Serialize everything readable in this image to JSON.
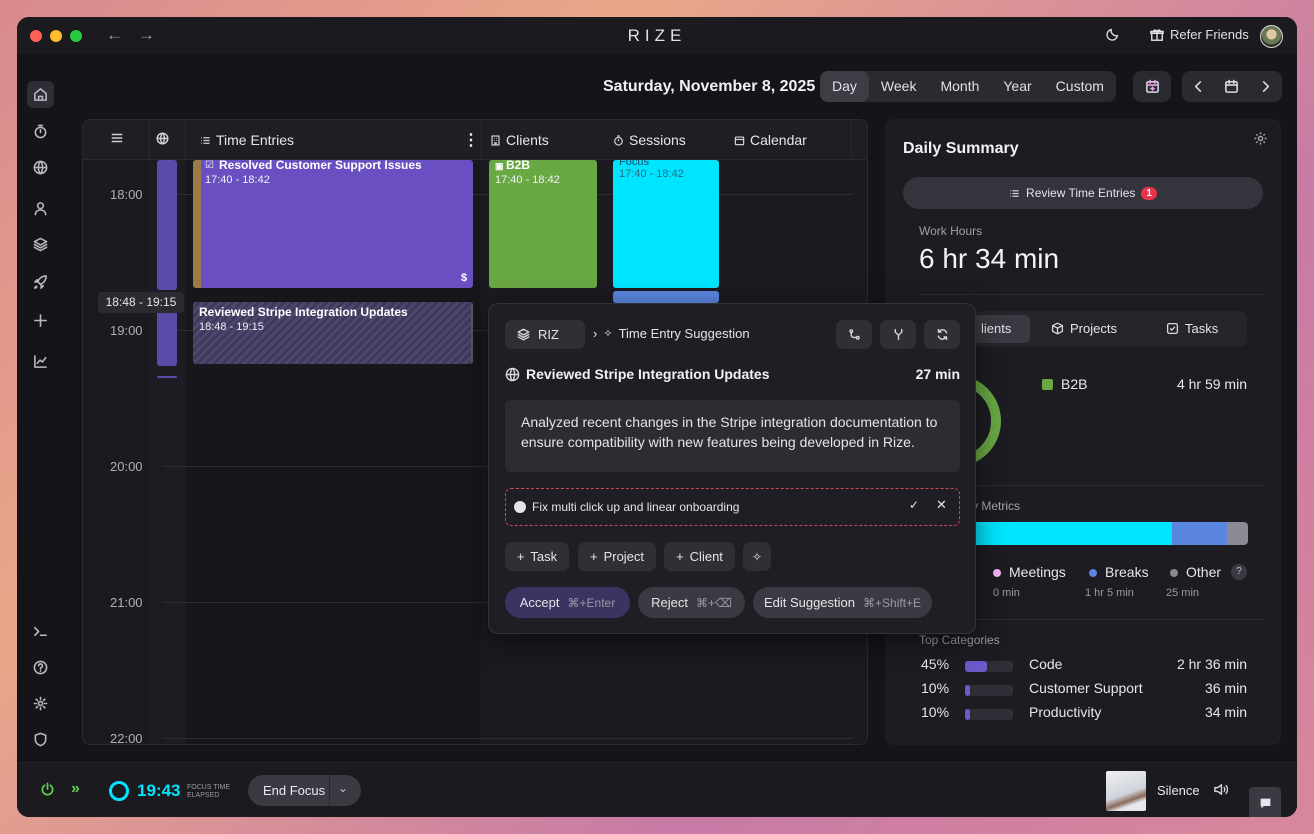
{
  "app": {
    "title": "RIZE"
  },
  "header": {
    "refer_label": "Refer Friends"
  },
  "date": {
    "title": "Saturday, November 8, 2025"
  },
  "views": [
    {
      "label": "Day",
      "active": true
    },
    {
      "label": "Week"
    },
    {
      "label": "Month"
    },
    {
      "label": "Year"
    },
    {
      "label": "Custom"
    }
  ],
  "calendar": {
    "columns": {
      "time_entries": "Time Entries",
      "clients": "Clients",
      "sessions": "Sessions",
      "calendar": "Calendar"
    },
    "hours": [
      "18:00",
      "19:00",
      "20:00",
      "21:00",
      "22:00"
    ],
    "tooltip": "18:48 - 19:15",
    "entries": [
      {
        "title": "Resolved Customer Support Issues",
        "time": "17:40 - 18:42",
        "badge": "$",
        "color": "#6a4fc2"
      },
      {
        "title": "Reviewed Stripe Integration Updates",
        "time": "18:48 - 19:15",
        "color": "#4a4a63"
      }
    ],
    "clients": [
      {
        "title": "B2B",
        "time": "17:40 - 18:42",
        "color": "#6aa844"
      }
    ],
    "sessions": [
      {
        "title": "Focus",
        "time": "17:40 - 18:42",
        "color": "#00e5ff"
      }
    ]
  },
  "popup": {
    "workspace": "RIZ",
    "breadcrumb": "Time Entry Suggestion",
    "title": "Reviewed Stripe Integration Updates",
    "duration": "27 min",
    "description": "Analyzed recent changes in the Stripe integration documentation to ensure compatibility with new features being developed in Rize.",
    "task_suggestion": "Fix multi click up and linear onboarding",
    "add_task": "Task",
    "add_project": "Project",
    "add_client": "Client",
    "accept": "Accept",
    "accept_kbd": "⌘+Enter",
    "reject": "Reject",
    "reject_kbd": "⌘+⌫",
    "edit": "Edit Suggestion",
    "edit_kbd": "⌘+Shift+E"
  },
  "summary": {
    "title": "Daily Summary",
    "review_label": "Review Time Entries",
    "review_count": "1",
    "work_hours_label": "Work Hours",
    "work_hours": "6 hr 34 min",
    "tabs": [
      "lients",
      "Projects",
      "Tasks"
    ],
    "client_name": "B2B",
    "client_time": "4 hr 59 min",
    "metrics_label": "y Metrics",
    "legend": [
      {
        "name": "Meetings",
        "value": "0 min",
        "color": "#f0b3f5"
      },
      {
        "name": "Breaks",
        "value": "1 hr 5 min",
        "color": "#5b86e0"
      },
      {
        "name": "Other",
        "value": "25 min",
        "color": "#8a8a92"
      }
    ],
    "legend_help": "?",
    "categories_label": "Top Categories",
    "categories": [
      {
        "pct": "45%",
        "fill": 0.45,
        "name": "Code",
        "time": "2 hr 36 min"
      },
      {
        "pct": "10%",
        "fill": 0.1,
        "name": "Customer Support",
        "time": "36 min"
      },
      {
        "pct": "10%",
        "fill": 0.1,
        "name": "Productivity",
        "time": "34 min"
      }
    ]
  },
  "footer": {
    "timer": "19:43",
    "timer_label_1": "FOCUS TIME",
    "timer_label_2": "ELAPSED",
    "end_focus": "End Focus",
    "track": "Silence"
  }
}
